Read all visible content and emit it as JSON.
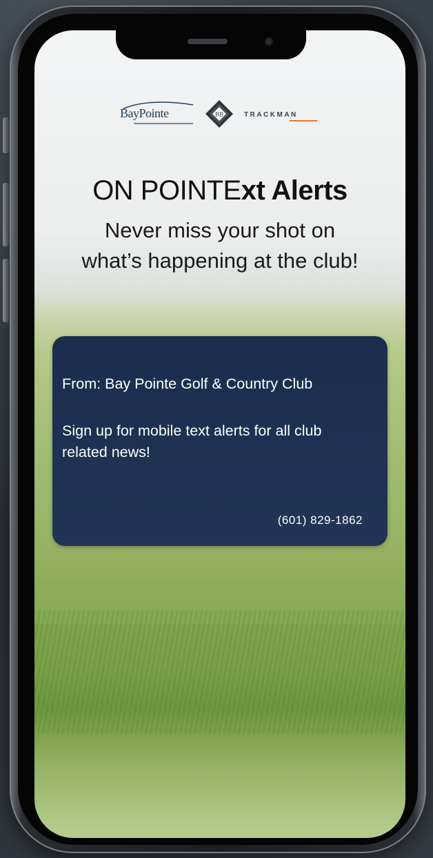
{
  "logos": {
    "baypointe_text": "BayPointe",
    "emblem_text": "BB",
    "trackman_text": "TRACKMAN"
  },
  "headline": {
    "part1": "ON POINTE",
    "part2": "xt Alerts"
  },
  "subline": {
    "line1": "Never miss your shot on",
    "line2": "what’s happening at the club!"
  },
  "message_card": {
    "from": "From: Bay Pointe Golf & Country Club",
    "body": "Sign up for mobile text alerts for all club related news!",
    "phone": "(601) 829-1862"
  },
  "colors": {
    "card_background": "#1b2d4d",
    "logo_blue": "#22405a",
    "trackman_accent": "#e07a2e"
  }
}
